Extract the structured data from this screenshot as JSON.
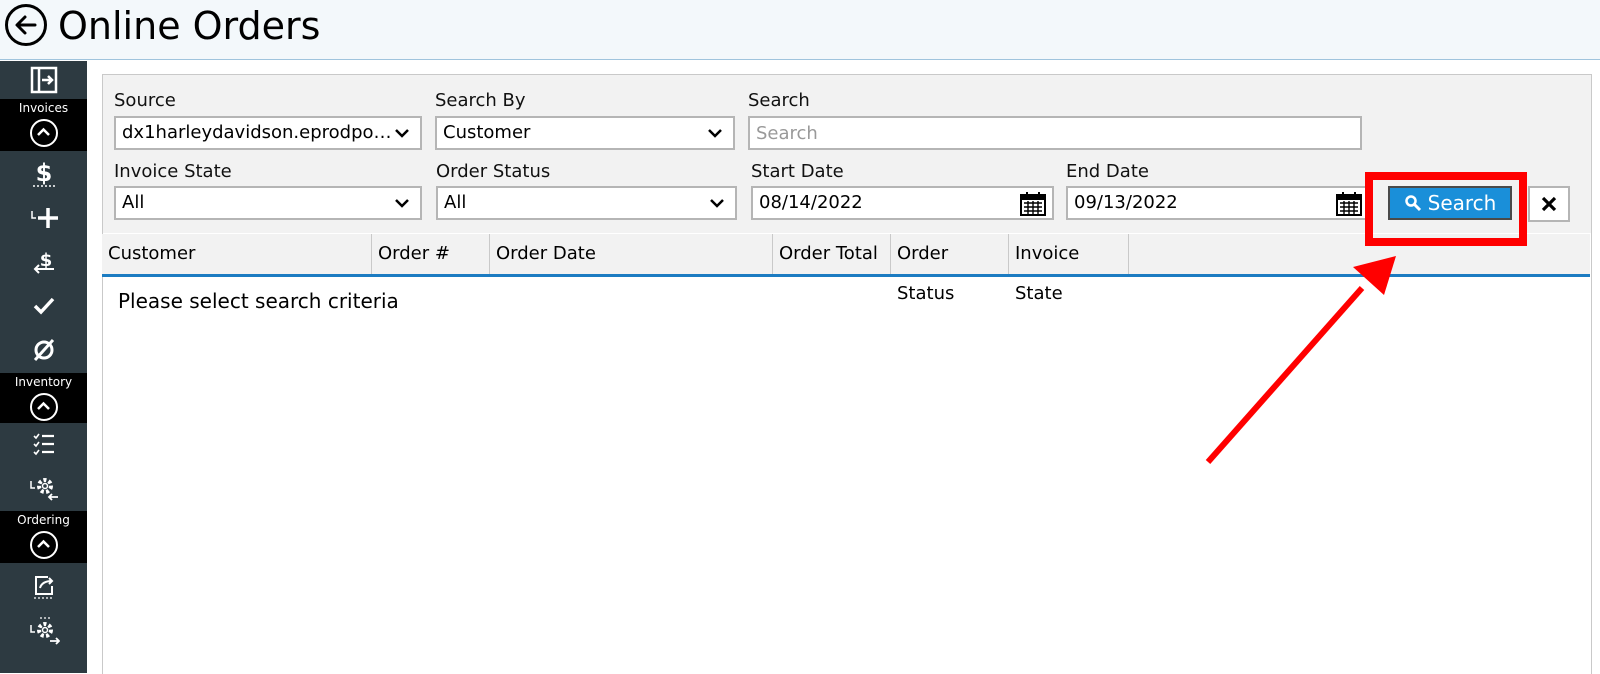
{
  "header": {
    "title": "Online Orders"
  },
  "sidebar": {
    "sections": [
      {
        "label": "Invoices"
      },
      {
        "label": "Inventory"
      },
      {
        "label": "Ordering"
      }
    ]
  },
  "filters": {
    "source": {
      "label": "Source",
      "value": "dx1harleydavidson.eprodpo…"
    },
    "search_by": {
      "label": "Search By",
      "value": "Customer"
    },
    "search": {
      "label": "Search",
      "placeholder": "Search"
    },
    "invoice_state": {
      "label": "Invoice State",
      "value": "All"
    },
    "order_status": {
      "label": "Order Status",
      "value": "All"
    },
    "start_date": {
      "label": "Start Date",
      "value": "08/14/2022"
    },
    "end_date": {
      "label": "End Date",
      "value": "09/13/2022"
    },
    "search_button": "Search"
  },
  "table": {
    "columns": [
      "Customer",
      "Order #",
      "Order Date",
      "Order Total",
      "Order Status",
      "Invoice State"
    ],
    "empty_message": "Please select search criteria"
  },
  "colors": {
    "accent": "#1a8fd9",
    "sidebar": "#2d3a41",
    "annotation": "#ff0000"
  }
}
